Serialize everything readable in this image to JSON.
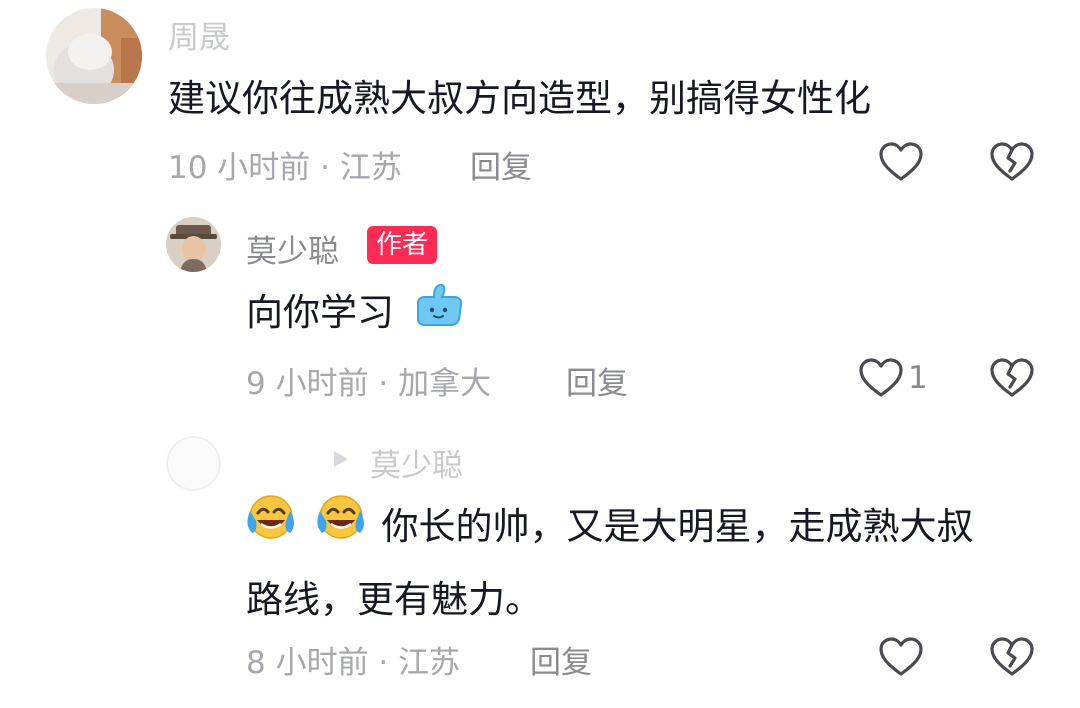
{
  "comments": [
    {
      "author": "周晟",
      "content": "建议你往成熟大叔方向造型，别搞得女性化",
      "meta": "10 小时前 · 江苏",
      "reply_label": "回复",
      "like_count": ""
    },
    {
      "author": "莫少聪",
      "badge": "作者",
      "content": "向你学习",
      "emoji": "thumbs-up-sticker",
      "meta": "9 小时前 · 加拿大",
      "reply_label": "回复",
      "like_count": "1"
    },
    {
      "author": "",
      "reply_to": "莫少聪",
      "content_line1": "你长的帅，又是大明星，走成熟大叔",
      "content_line2": "路线，更有魅力。",
      "emoji": "laughing-crying-emoji",
      "meta": "8 小时前 · 江苏",
      "reply_label": "回复",
      "like_count": ""
    }
  ],
  "icons": {
    "like": "heart-outline-icon",
    "dislike": "broken-heart-icon",
    "reply_arrow": "triangle-right-icon"
  },
  "colors": {
    "text": "#161823",
    "secondary": "#8a8b91",
    "author_badge": "#fe2c55"
  }
}
